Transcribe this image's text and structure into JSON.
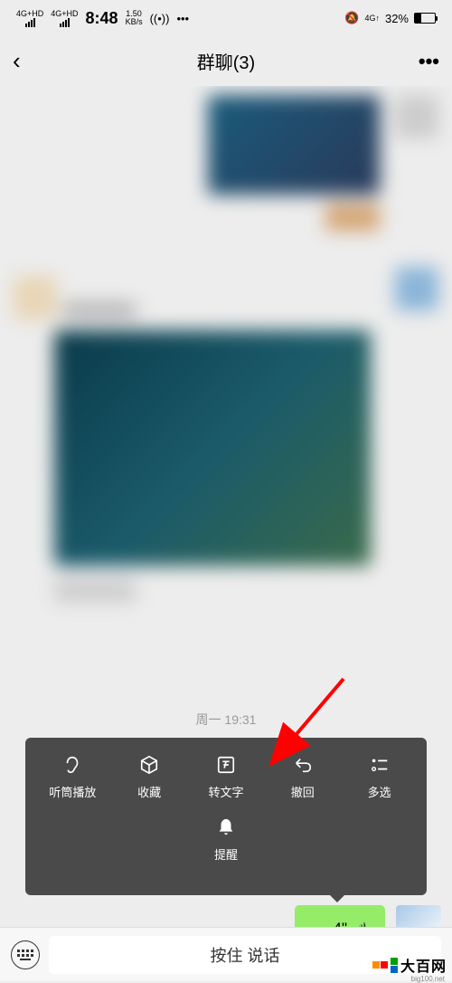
{
  "status_bar": {
    "net1": "4G+HD",
    "net2": "4G+HD",
    "time": "8:48",
    "speed": "1.50",
    "speed_unit": "KB/s",
    "net_right": "4G↑",
    "battery_pct": "32%"
  },
  "header": {
    "title": "群聊(3)"
  },
  "chat": {
    "timestamp": "周一 19:31",
    "voice_duration": "4\""
  },
  "context_menu": {
    "items_row1": [
      {
        "label": "听筒播放",
        "icon": "ear-icon"
      },
      {
        "label": "收藏",
        "icon": "box-icon"
      },
      {
        "label": "转文字",
        "icon": "text-convert-icon"
      },
      {
        "label": "撤回",
        "icon": "undo-icon"
      },
      {
        "label": "多选",
        "icon": "multiselect-icon"
      }
    ],
    "items_row2": [
      {
        "label": "提醒",
        "icon": "bell-icon"
      }
    ]
  },
  "input_bar": {
    "voice_prompt": "按住 说话"
  },
  "watermark": {
    "text": "大百网",
    "url": "big100.net"
  }
}
